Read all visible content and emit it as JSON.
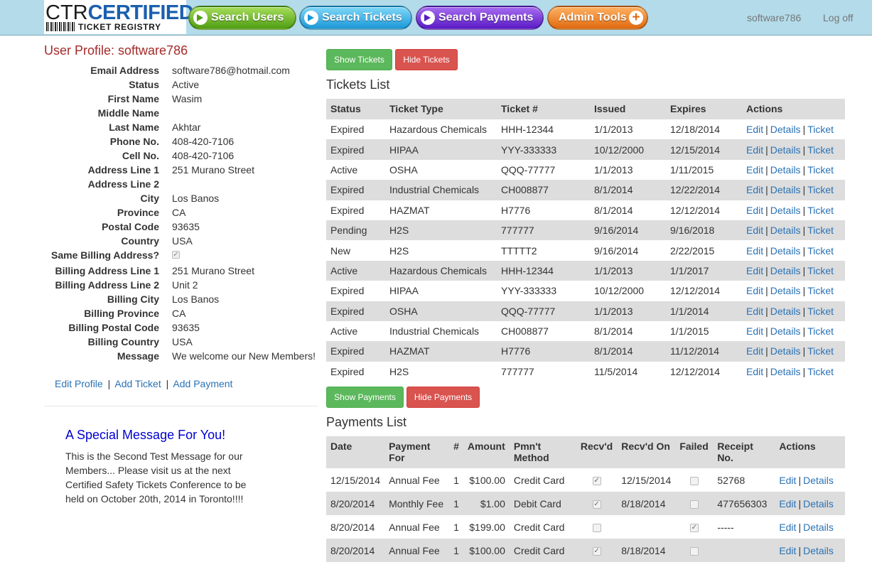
{
  "header": {
    "logo_ctr": "CTR",
    "logo_certified": "CERTIFIED",
    "logo_sub": "TICKET REGISTRY",
    "nav": {
      "search_users": "Search Users",
      "search_tickets": "Search Tickets",
      "search_payments": "Search Payments",
      "admin_tools": "Admin Tools"
    },
    "username": "software786",
    "logoff": "Log off"
  },
  "profile": {
    "title": "User Profile: software786",
    "fields": [
      {
        "label": "Email Address",
        "value": "software786@hotmail.com"
      },
      {
        "label": "Status",
        "value": "Active"
      },
      {
        "label": "First Name",
        "value": "Wasim"
      },
      {
        "label": "Middle Name",
        "value": ""
      },
      {
        "label": "Last Name",
        "value": "Akhtar"
      },
      {
        "label": "Phone No.",
        "value": "408-420-7106"
      },
      {
        "label": "Cell No.",
        "value": "408-420-7106"
      },
      {
        "label": "Address Line 1",
        "value": "251 Murano Street"
      },
      {
        "label": "Address Line 2",
        "value": ""
      },
      {
        "label": "City",
        "value": "Los Banos"
      },
      {
        "label": "Province",
        "value": "CA"
      },
      {
        "label": "Postal Code",
        "value": "93635"
      },
      {
        "label": "Country",
        "value": "USA"
      },
      {
        "label": "Same Billing Address?",
        "value": "checked"
      },
      {
        "label": "Billing Address Line 1",
        "value": "251 Murano Street"
      },
      {
        "label": "Billing Address Line 2",
        "value": "Unit 2"
      },
      {
        "label": "Billing City",
        "value": "Los Banos"
      },
      {
        "label": "Billing Province",
        "value": "CA"
      },
      {
        "label": "Billing Postal Code",
        "value": "93635"
      },
      {
        "label": "Billing Country",
        "value": "USA"
      },
      {
        "label": "Message",
        "value": "We welcome our New Members!"
      }
    ],
    "links": {
      "edit_profile": "Edit Profile",
      "add_ticket": "Add Ticket",
      "add_payment": "Add Payment",
      "separator": "|"
    }
  },
  "special_message": {
    "title": "A Special Message For You!",
    "body": "This is the Second Test Message for our Members... Please visit us at the next Certified Safety Tickets Conference to be held on October 20th, 2014 in Toronto!!!!"
  },
  "tickets": {
    "show_button": "Show Tickets",
    "hide_button": "Hide Tickets",
    "title": "Tickets List",
    "columns": [
      "Status",
      "Ticket Type",
      "Ticket #",
      "Issued",
      "Expires",
      "Actions"
    ],
    "action_labels": {
      "edit": "Edit",
      "details": "Details",
      "ticket": "Ticket",
      "sep": "|"
    },
    "rows": [
      {
        "status": "Expired",
        "type": "Hazardous Chemicals",
        "number": "HHH-12344",
        "issued": "1/1/2013",
        "expires": "12/18/2014"
      },
      {
        "status": "Expired",
        "type": "HIPAA",
        "number": "YYY-333333",
        "issued": "10/12/2000",
        "expires": "12/15/2014"
      },
      {
        "status": "Active",
        "type": "OSHA",
        "number": "QQQ-77777",
        "issued": "1/1/2013",
        "expires": "1/11/2015"
      },
      {
        "status": "Expired",
        "type": "Industrial Chemicals",
        "number": "CH008877",
        "issued": "8/1/2014",
        "expires": "12/22/2014"
      },
      {
        "status": "Expired",
        "type": "HAZMAT",
        "number": "H7776",
        "issued": "8/1/2014",
        "expires": "12/12/2014"
      },
      {
        "status": "Pending",
        "type": "H2S",
        "number": "777777",
        "issued": "9/16/2014",
        "expires": "9/16/2018"
      },
      {
        "status": "New",
        "type": "H2S",
        "number": "TTTTT2",
        "issued": "9/16/2014",
        "expires": "2/22/2015"
      },
      {
        "status": "Active",
        "type": "Hazardous Chemicals",
        "number": "HHH-12344",
        "issued": "1/1/2013",
        "expires": "1/1/2017"
      },
      {
        "status": "Expired",
        "type": "HIPAA",
        "number": "YYY-333333",
        "issued": "10/12/2000",
        "expires": "12/12/2014"
      },
      {
        "status": "Expired",
        "type": "OSHA",
        "number": "QQQ-77777",
        "issued": "1/1/2013",
        "expires": "1/1/2014"
      },
      {
        "status": "Active",
        "type": "Industrial Chemicals",
        "number": "CH008877",
        "issued": "8/1/2014",
        "expires": "1/1/2015"
      },
      {
        "status": "Expired",
        "type": "HAZMAT",
        "number": "H7776",
        "issued": "8/1/2014",
        "expires": "11/12/2014"
      },
      {
        "status": "Expired",
        "type": "H2S",
        "number": "777777",
        "issued": "11/5/2014",
        "expires": "12/12/2014"
      }
    ]
  },
  "payments": {
    "show_button": "Show Payments",
    "hide_button": "Hide Payments",
    "title": "Payments List",
    "columns": [
      "Date",
      "Payment For",
      "#",
      "Amount",
      "Pmn't Method",
      "Recv'd",
      "Recv'd On",
      "Failed",
      "Receipt No.",
      "Actions"
    ],
    "action_labels": {
      "edit": "Edit",
      "details": "Details",
      "sep": "|"
    },
    "rows": [
      {
        "date": "12/15/2014",
        "for": "Annual Fee",
        "qty": "1",
        "amount": "$100.00",
        "method": "Credit Card",
        "received": true,
        "received_on": "12/15/2014",
        "failed": false,
        "receipt": "52768"
      },
      {
        "date": "8/20/2014",
        "for": "Monthly Fee",
        "qty": "1",
        "amount": "$1.00",
        "method": "Debit Card",
        "received": true,
        "received_on": "8/18/2014",
        "failed": false,
        "receipt": "477656303"
      },
      {
        "date": "8/20/2014",
        "for": "Annual Fee",
        "qty": "1",
        "amount": "$199.00",
        "method": "Credit Card",
        "received": false,
        "received_on": "",
        "failed": true,
        "receipt": "-----"
      },
      {
        "date": "8/20/2014",
        "for": "Annual Fee",
        "qty": "1",
        "amount": "$100.00",
        "method": "Credit Card",
        "received": true,
        "received_on": "8/18/2014",
        "failed": false,
        "receipt": ""
      }
    ]
  }
}
